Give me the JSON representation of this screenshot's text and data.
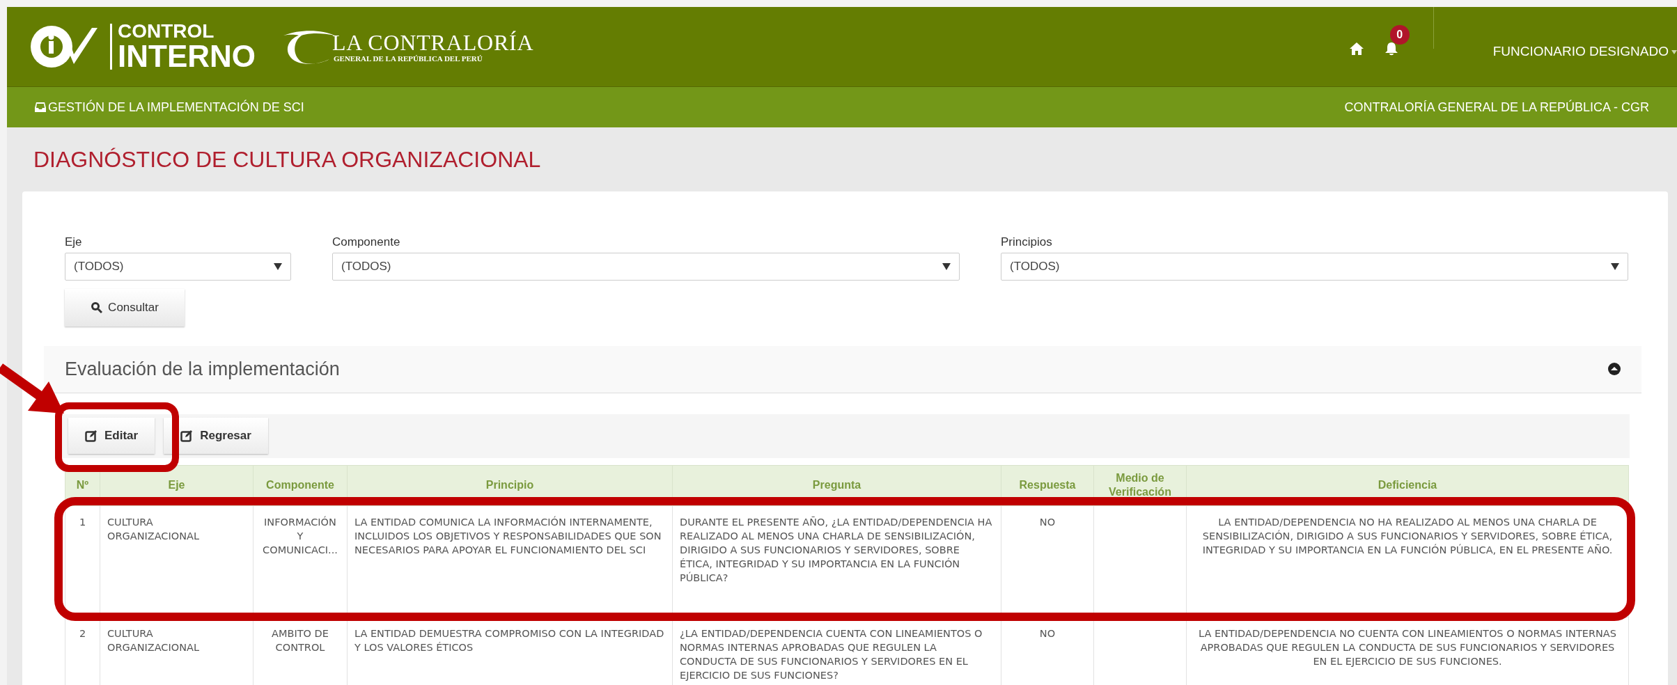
{
  "header": {
    "logo": {
      "line_1": "CONTROL",
      "line_2": "INTERNO"
    },
    "org_logo": {
      "name": "LA CONTRALORÍA",
      "subtitle": "GENERAL DE LA REPÚBLICA DEL PERÚ"
    },
    "notifications": {
      "count": "0"
    },
    "user": "FUNCIONARIO DESIGNADO"
  },
  "subbar": {
    "module": "GESTIÓN DE LA IMPLEMENTACIÓN DE SCI",
    "entity": "CONTRALORÍA GENERAL DE LA REPÚBLICA - CGR"
  },
  "page_title": "DIAGNÓSTICO DE CULTURA ORGANIZACIONAL",
  "filters": [
    {
      "label": "Eje",
      "value": "(TODOS)"
    },
    {
      "label": "Componente",
      "value": "(TODOS)"
    },
    {
      "label": "Principios",
      "value": "(TODOS)"
    }
  ],
  "consult_button": "Consultar",
  "panel": {
    "title": "Evaluación de la implementación",
    "expanded": true,
    "buttons": [
      "Editar",
      "Regresar"
    ]
  },
  "table": {
    "columns": [
      "Nº",
      "Eje",
      "Componente",
      "Principio",
      "Pregunta",
      "Respuesta",
      "Medio de Verificación",
      "Deficiencia"
    ],
    "rows": [
      {
        "cells": [
          "1",
          "CULTURA ORGANIZACIONAL",
          "INFORMACIÓN Y COMUNICACI...",
          "LA ENTIDAD COMUNICA LA INFORMACIÓN INTERNAMENTE, INCLUIDOS LOS OBJETIVOS Y RESPONSABILIDADES QUE SON NECESARIOS PARA APOYAR EL FUNCIONAMIENTO DEL SCI",
          "DURANTE EL PRESENTE AÑO, ¿LA ENTIDAD/DEPENDENCIA HA REALIZADO AL MENOS UNA CHARLA DE SENSIBILIZACIÓN, DIRIGIDO A SUS FUNCIONARIOS Y SERVIDORES, SOBRE ÉTICA, INTEGRIDAD Y SU IMPORTANCIA EN LA FUNCIÓN PÚBLICA?",
          "NO",
          "",
          "LA ENTIDAD/DEPENDENCIA NO HA REALIZADO AL MENOS UNA CHARLA DE SENSIBILIZACIÓN, DIRIGIDO A SUS FUNCIONARIOS Y SERVIDORES, SOBRE ÉTICA, INTEGRIDAD Y SU IMPORTANCIA EN LA FUNCIÓN PÚBLICA, EN EL PRESENTE AÑO."
        ]
      },
      {
        "cells": [
          "2",
          "CULTURA ORGANIZACIONAL",
          "AMBITO DE CONTROL",
          "LA ENTIDAD DEMUESTRA COMPROMISO CON LA INTEGRIDAD Y LOS VALORES ÉTICOS",
          "¿LA ENTIDAD/DEPENDENCIA CUENTA CON LINEAMIENTOS O NORMAS INTERNAS APROBADAS QUE REGULEN LA CONDUCTA DE SUS FUNCIONARIOS Y SERVIDORES EN EL EJERCICIO DE SUS FUNCIONES?",
          "NO",
          "",
          "LA ENTIDAD/DEPENDENCIA NO CUENTA CON LINEAMIENTOS O NORMAS INTERNAS APROBADAS QUE REGULEN LA CONDUCTA DE SUS FUNCIONARIOS Y SERVIDORES EN EL EJERCICIO DE SUS FUNCIONES."
        ]
      }
    ]
  }
}
